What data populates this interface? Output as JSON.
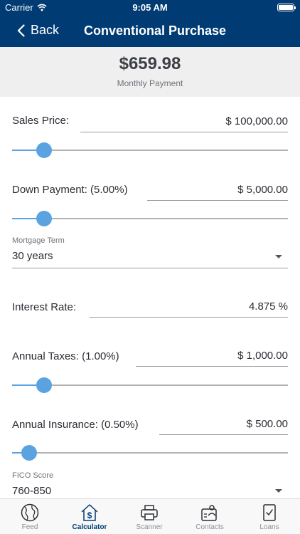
{
  "status_bar": {
    "carrier": "Carrier",
    "time": "9:05 AM"
  },
  "nav": {
    "back_label": "Back",
    "title": "Conventional Purchase"
  },
  "summary": {
    "amount": "$659.98",
    "label": "Monthly Payment"
  },
  "fields": {
    "sales_price": {
      "label": "Sales Price:",
      "value": "$ 100,000.00",
      "slider_fraction": 0.115
    },
    "down_payment": {
      "label": "Down Payment: (5.00%)",
      "value": "$ 5,000.00",
      "slider_fraction": 0.115
    },
    "mortgage_term": {
      "label": "Mortgage Term",
      "value": "30 years"
    },
    "interest_rate": {
      "label": "Interest Rate:",
      "value": "4.875 %"
    },
    "annual_taxes": {
      "label": "Annual Taxes: (1.00%)",
      "value": "$ 1,000.00",
      "slider_fraction": 0.115
    },
    "annual_insurance": {
      "label": "Annual Insurance: (0.50%)",
      "value": "$ 500.00",
      "slider_fraction": 0.062
    },
    "fico_score": {
      "label": "FICO Score",
      "value": "760-850"
    }
  },
  "tabs": [
    {
      "label": "Feed",
      "icon": "globe-icon",
      "active": false
    },
    {
      "label": "Calculator",
      "icon": "house-dollar-icon",
      "active": true
    },
    {
      "label": "Scanner",
      "icon": "printer-icon",
      "active": false
    },
    {
      "label": "Contacts",
      "icon": "contact-card-icon",
      "active": false
    },
    {
      "label": "Loans",
      "icon": "checklist-icon",
      "active": false
    }
  ],
  "colors": {
    "header": "#003b73",
    "slider": "#5aa3e0",
    "summary_bg": "#efefef",
    "active_tab": "#003b73",
    "inactive_tab": "#8d8f93"
  }
}
